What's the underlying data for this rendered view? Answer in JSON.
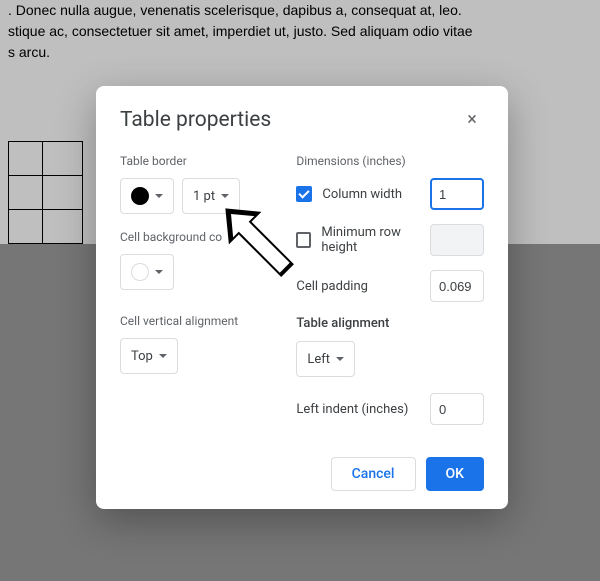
{
  "background": {
    "text_line1": ". Donec nulla augue, venenatis scelerisque, dapibus a, consequat at, leo.",
    "text_line2": "stique ac, consectetuer sit amet, imperdiet ut, justo. Sed aliquam odio vitae",
    "text_line3": "s arcu."
  },
  "modal": {
    "title": "Table properties",
    "left": {
      "border_label": "Table border",
      "border_width": "1 pt",
      "cell_bg_label": "Cell background co",
      "vert_align_label": "Cell vertical alignment",
      "vert_align_value": "Top"
    },
    "right": {
      "dimensions_label": "Dimensions  (inches)",
      "col_width_label": "Column width",
      "col_width_value": "1",
      "min_row_label": "Minimum row height",
      "cell_padding_label": "Cell padding",
      "cell_padding_value": "0.069",
      "table_align_label": "Table alignment",
      "table_align_value": "Left",
      "left_indent_label": "Left indent  (inches)",
      "left_indent_value": "0"
    },
    "footer": {
      "cancel": "Cancel",
      "ok": "OK"
    }
  }
}
